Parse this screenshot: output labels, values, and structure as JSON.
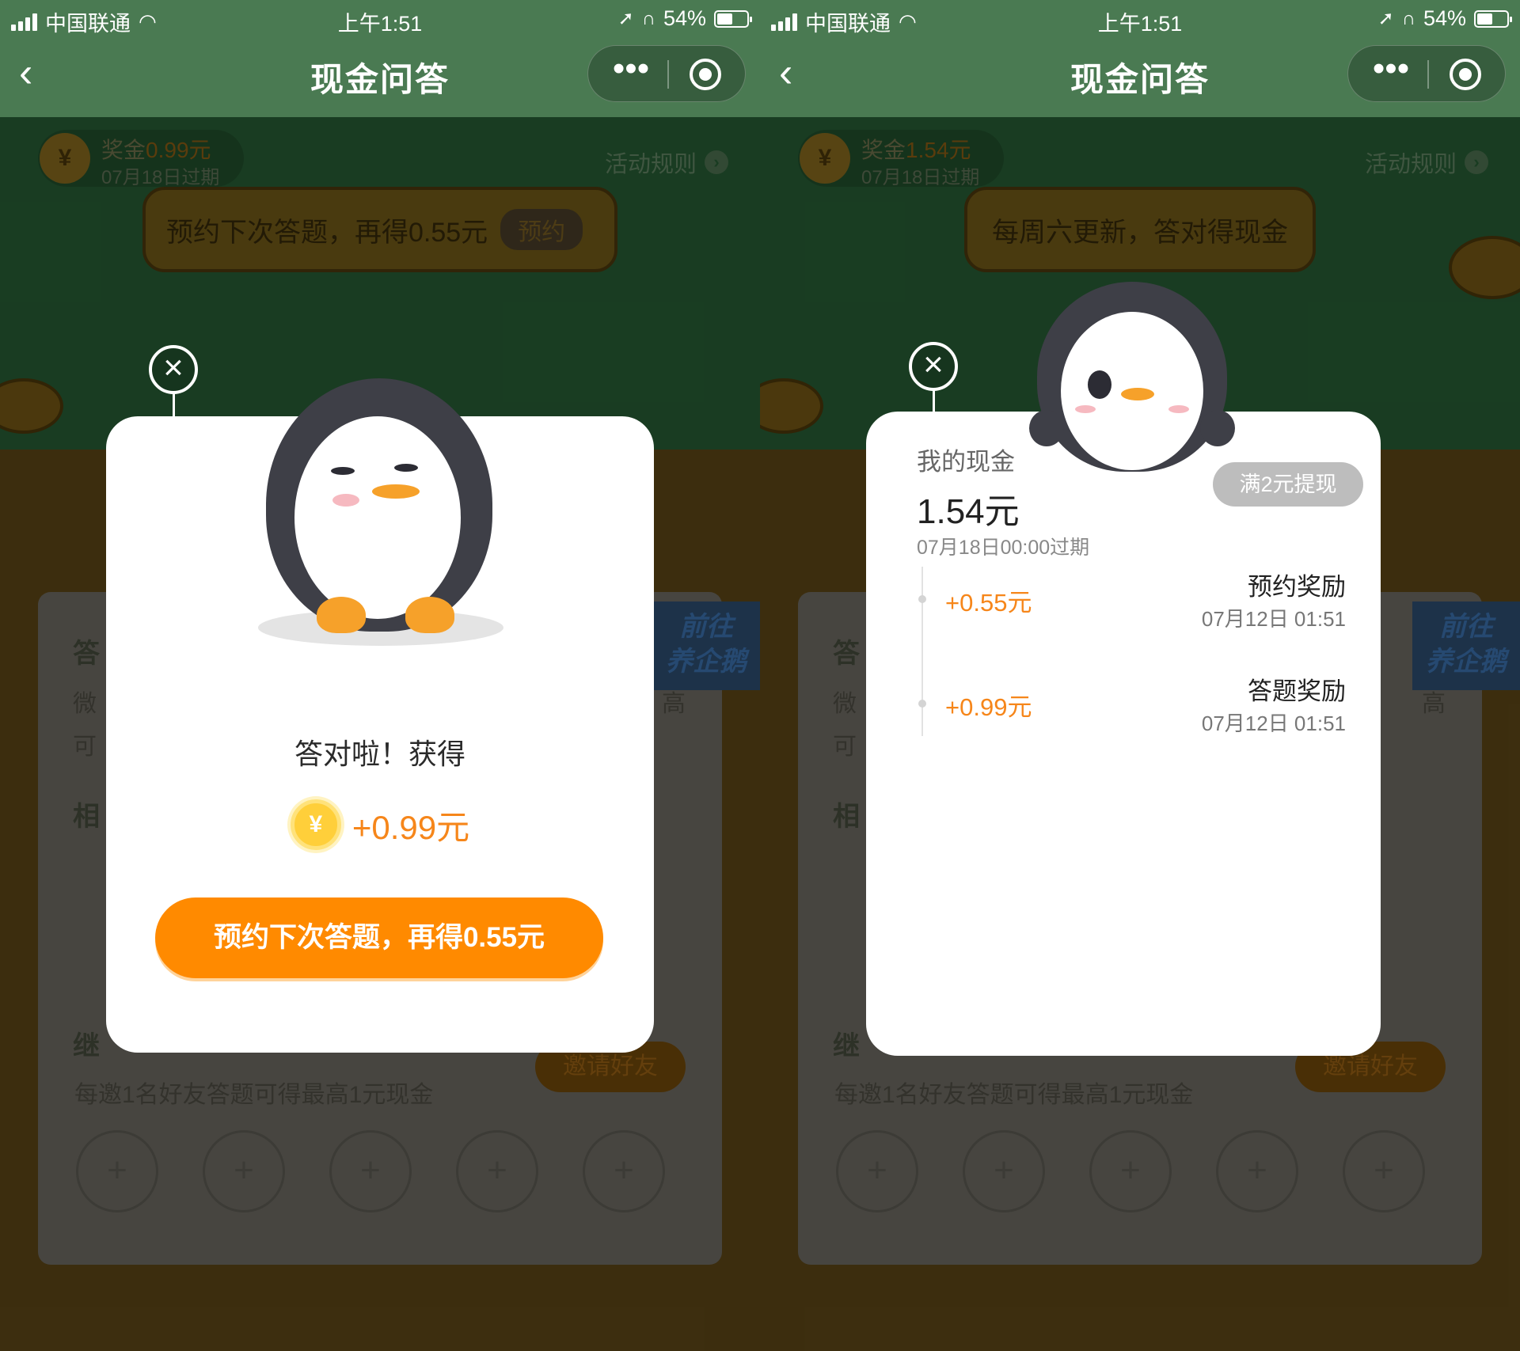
{
  "status_bar": {
    "carrier": "中国联通",
    "time": "上午1:51",
    "battery": "54%",
    "battery_level": 0.54
  },
  "nav": {
    "back": "‹",
    "title": "现金问答",
    "more": "•••"
  },
  "background_page": {
    "prize_prefix": "奖金",
    "rules": "活动规则",
    "card_labels": [
      "答",
      "微",
      "可",
      "相",
      "继"
    ],
    "go_badge": [
      "前往",
      "养企鹅"
    ],
    "side_text": "高",
    "invite_desc": "每邀1名好友答题可得最高1元现金",
    "invite_button": "邀请好友",
    "plus_slots": [
      "+",
      "+",
      "+",
      "+",
      "+"
    ]
  },
  "left_screen": {
    "prize_amount": "0.99元",
    "prize_expiry": "07月18日过期",
    "bubble_text": "预约下次答题，再得0.55元",
    "bubble_chip": "预约",
    "modal": {
      "correct_text": "答对啦！获得",
      "coin_symbol": "¥",
      "reward": "+0.99元",
      "cta": "预约下次答题，再得0.55元"
    }
  },
  "right_screen": {
    "prize_amount": "1.54元",
    "prize_expiry": "07月18日过期",
    "bubble_text": "每周六更新，答对得现金",
    "modal": {
      "label": "我的现金",
      "amount": "1.54元",
      "expiry": "07月18日00:00过期",
      "withdraw": "满2元提现",
      "records": [
        {
          "amount": "+0.55元",
          "name": "预约奖励",
          "time": "07月12日 01:51"
        },
        {
          "amount": "+0.99元",
          "name": "答题奖励",
          "time": "07月12日 01:51"
        }
      ]
    }
  },
  "colors": {
    "nav_green": "#4a7a52",
    "accent_orange": "#ff8a00",
    "reward_orange": "#f6861a"
  }
}
